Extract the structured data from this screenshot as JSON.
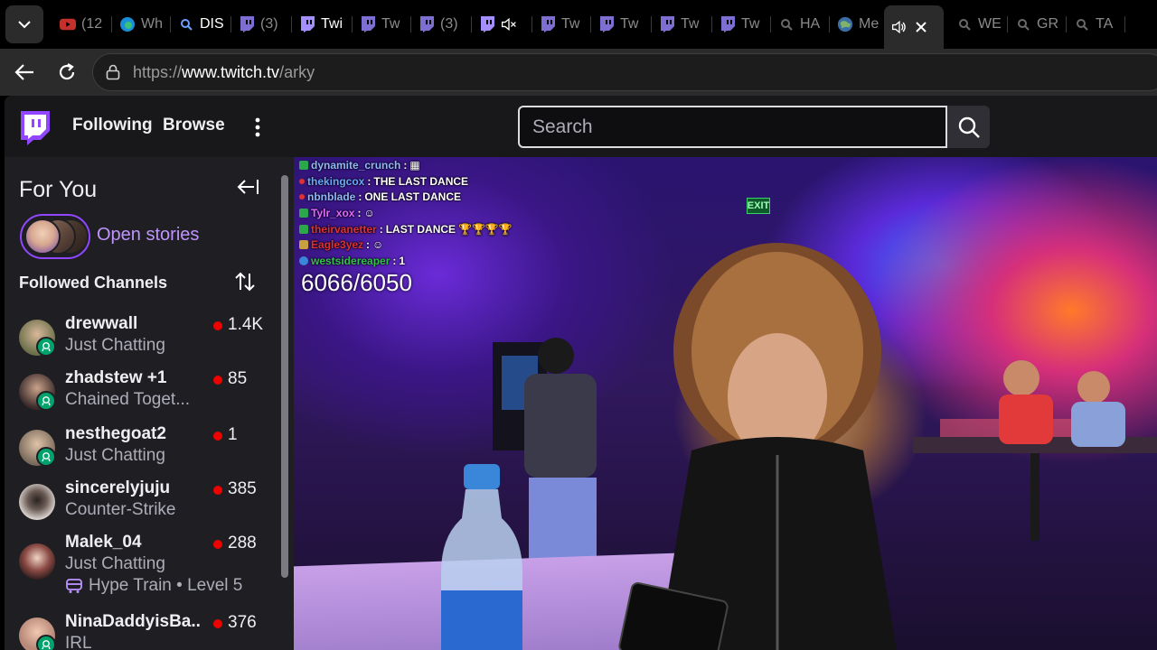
{
  "browser": {
    "tabs": [
      {
        "icon": "youtube-icon",
        "label": "(12"
      },
      {
        "icon": "edge-icon",
        "label": "Wh"
      },
      {
        "icon": "search-icon",
        "label": "DIS"
      },
      {
        "icon": "twitch-icon",
        "label": "(3)"
      },
      {
        "icon": "twitch-icon",
        "label": "Twi"
      },
      {
        "icon": "twitch-icon",
        "label": "Tw"
      },
      {
        "icon": "twitch-icon",
        "label": "(3)"
      },
      {
        "icon": "twitch-icon",
        "label": ""
      },
      {
        "icon": "twitch-icon",
        "label": "Tw"
      },
      {
        "icon": "twitch-icon",
        "label": "Tw"
      },
      {
        "icon": "twitch-icon",
        "label": "Tw"
      },
      {
        "icon": "twitch-icon",
        "label": "Tw"
      },
      {
        "icon": "search-icon",
        "label": "HA"
      },
      {
        "icon": "globe-icon",
        "label": "Me"
      },
      {
        "icon": "speaker-icon",
        "label": ""
      },
      {
        "icon": "search-icon",
        "label": "WE"
      },
      {
        "icon": "search-icon",
        "label": "GR"
      },
      {
        "icon": "search-icon",
        "label": "TA"
      }
    ],
    "url_prefix": "https://",
    "url_host": "www.twitch.tv",
    "url_path": "/arky"
  },
  "twitch": {
    "nav": {
      "following": "Following",
      "browse": "Browse",
      "search_placeholder": "Search"
    },
    "sidebar": {
      "for_you": "For You",
      "open_stories": "Open stories",
      "followed_title": "Followed Channels",
      "channels": [
        {
          "name": "drewwall",
          "category": "Just Chatting",
          "viewers": "1.4K",
          "avatar_color": "#6b6f4a"
        },
        {
          "name": "zhadstew +1",
          "category": "Chained Toget...",
          "viewers": "85",
          "avatar_color": "#3a2a2a"
        },
        {
          "name": "nesthegoat2",
          "category": "Just Chatting",
          "viewers": "1",
          "avatar_color": "#7a6a5a"
        },
        {
          "name": "sincerelyjuju",
          "category": "Counter-Strike",
          "viewers": "385",
          "avatar_color": "#e6e0dc"
        },
        {
          "name": "Malek_04",
          "category": "Just Chatting",
          "viewers": "288",
          "avatar_color": "#c9a9a9",
          "extra": "Hype Train • Level 5"
        },
        {
          "name": "NinaDaddyisBa...",
          "category": "IRL",
          "viewers": "376",
          "avatar_color": "#b98a7a"
        }
      ]
    },
    "stream": {
      "exit_sign": "EXIT",
      "goal_counter": "6066/6050",
      "chat": [
        {
          "user": "dynamite_crunch",
          "user_color": "#8fb8ff",
          "message": ""
        },
        {
          "user": "thekingcox",
          "user_color": "#6aa8ff",
          "message": "THE LAST DANCE"
        },
        {
          "user": "nbnblade",
          "user_color": "#8fb8ff",
          "message": "ONE LAST DANCE"
        },
        {
          "user": "Tylr_xox",
          "user_color": "#e06bff",
          "message": ""
        },
        {
          "user": "theirvanetter",
          "user_color": "#e03030",
          "message": "LAST DANCE"
        },
        {
          "user": "Eagle3yez",
          "user_color": "#e03030",
          "message": ""
        },
        {
          "user": "westsidereaper",
          "user_color": "#33c24d",
          "message": "1"
        }
      ]
    }
  },
  "colors": {
    "twitch_purple": "#9147ff",
    "live_red": "#eb0400"
  }
}
